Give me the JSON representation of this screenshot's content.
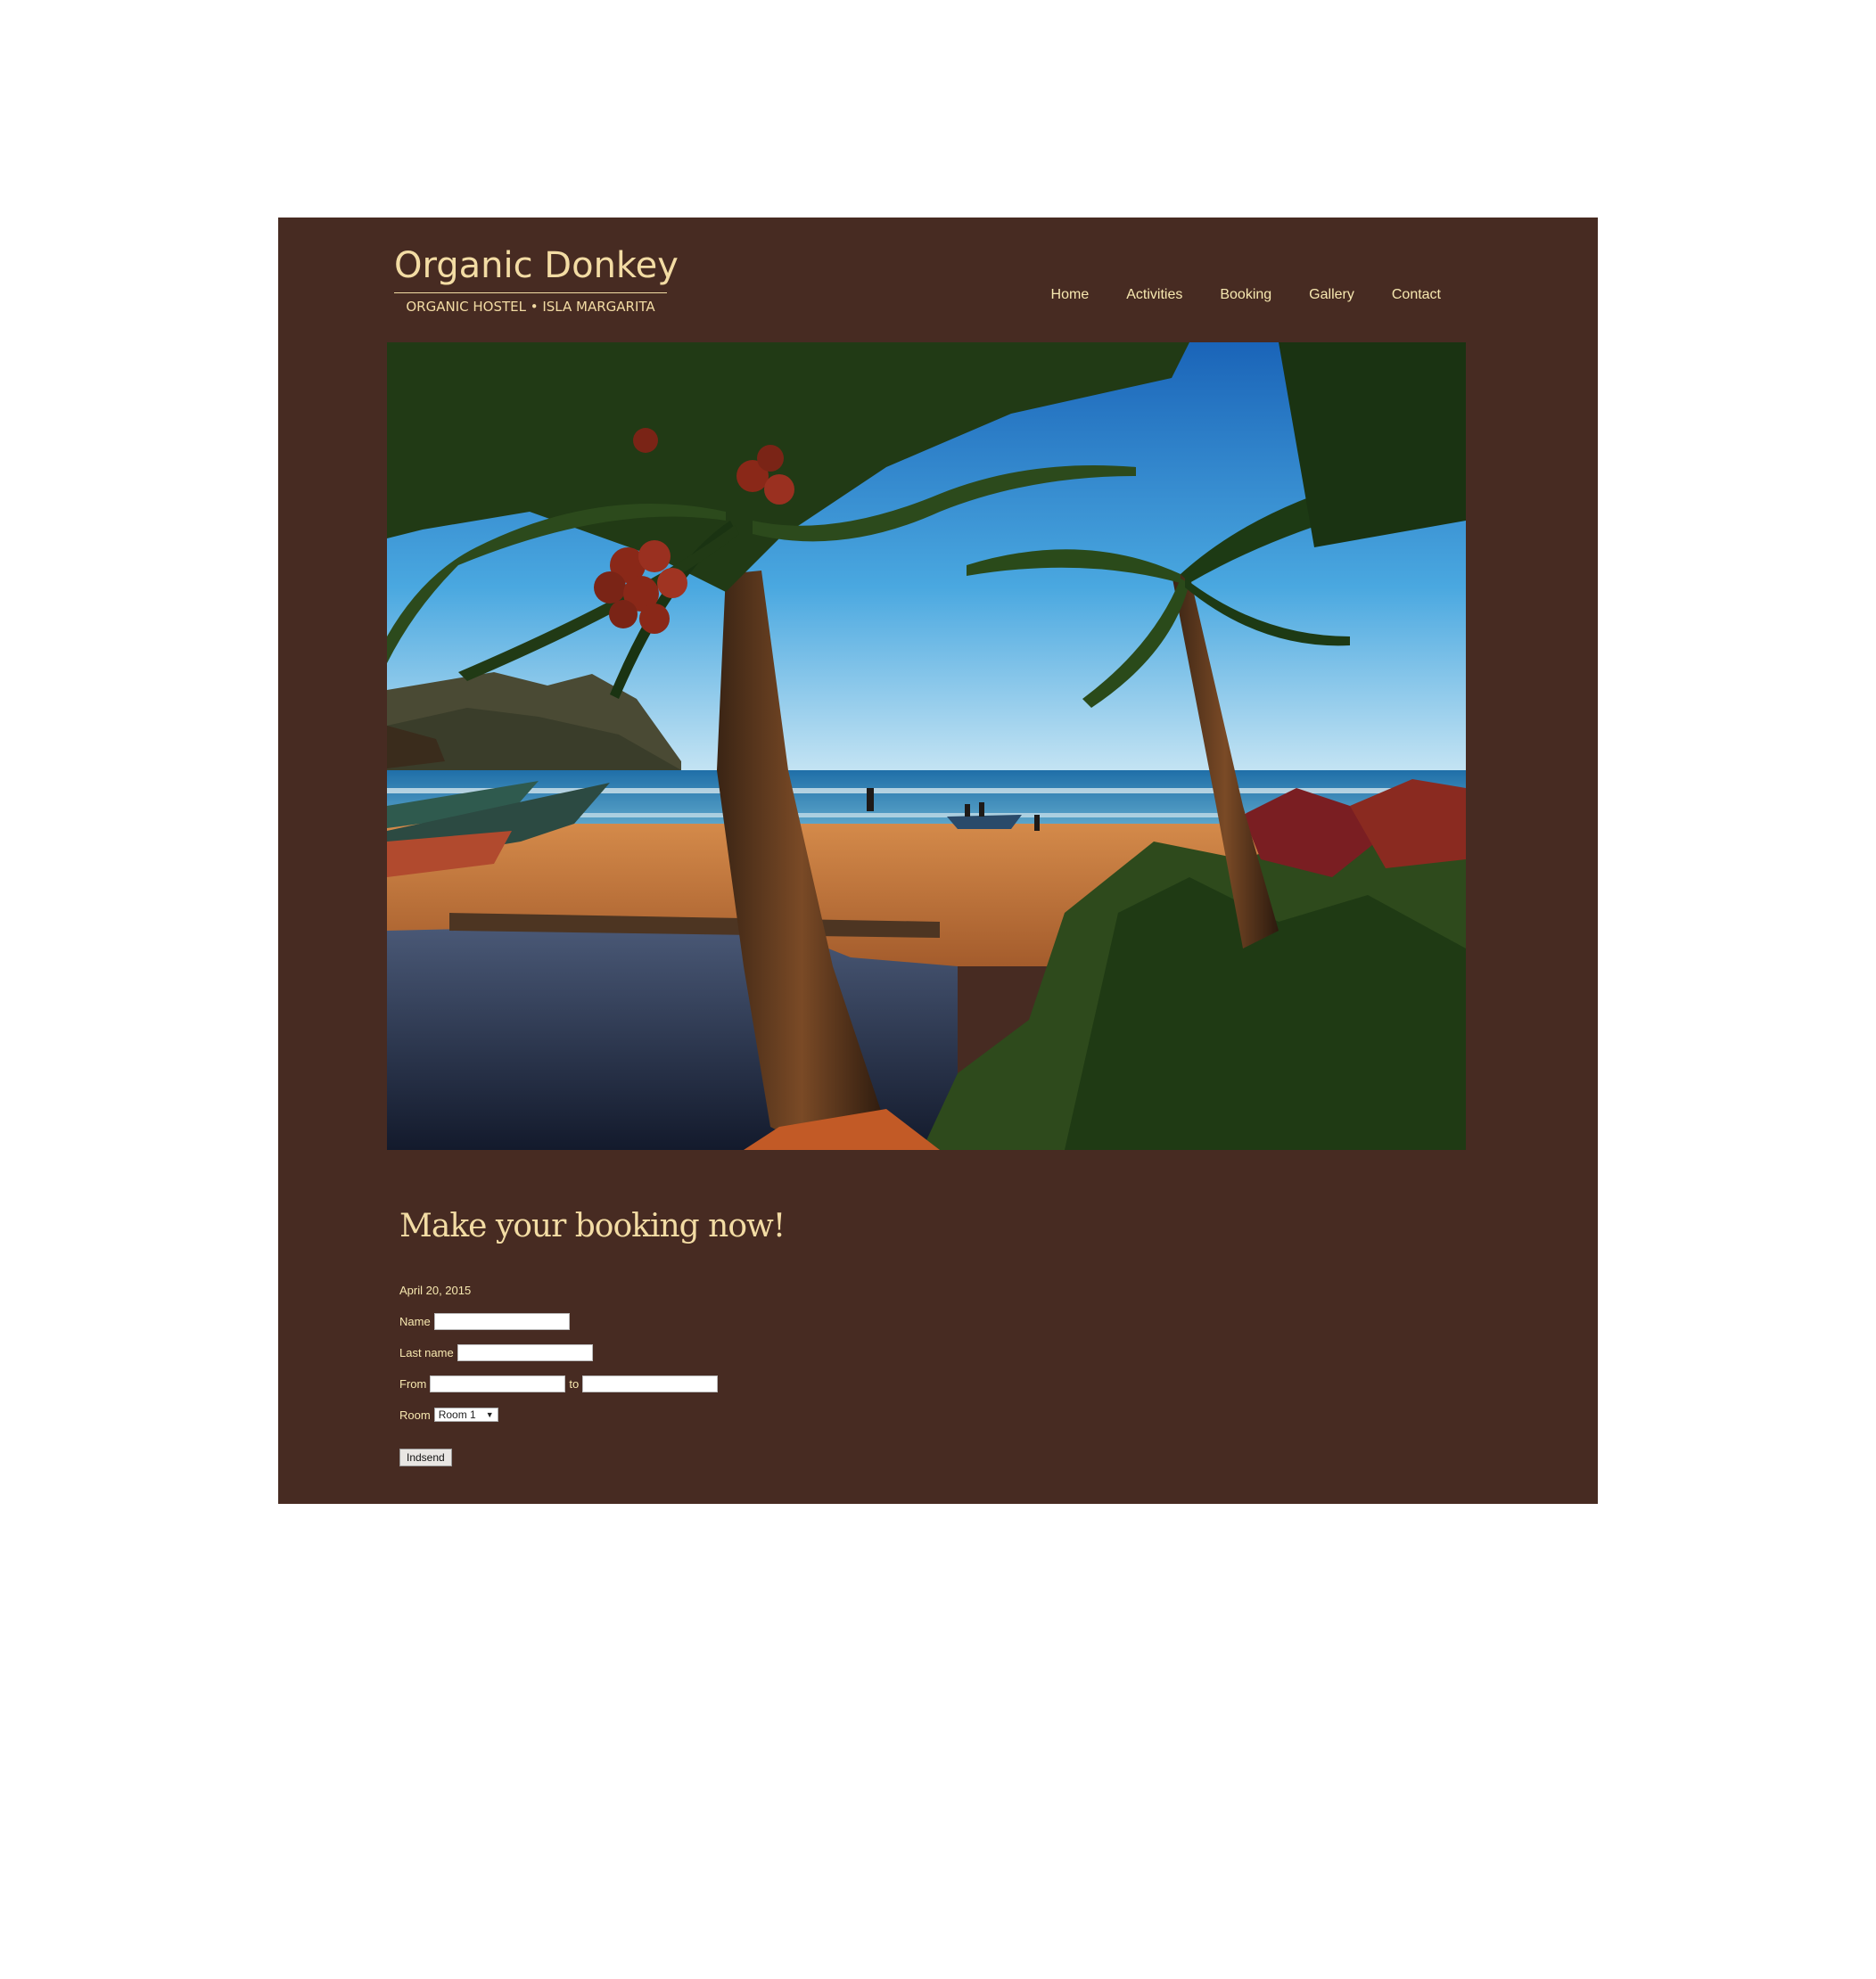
{
  "header": {
    "logo_title": "Organic Donkey",
    "logo_subtitle": "ORGANIC HOSTEL • ISLA MARGARITA"
  },
  "nav": {
    "items": [
      "Home",
      "Activities",
      "Booking",
      "Gallery",
      "Contact"
    ]
  },
  "hero": {
    "image": "beach-palm-trees-photo"
  },
  "booking": {
    "heading": "Make your booking now!",
    "date": "April 20, 2015",
    "name_label": "Name",
    "name_value": "",
    "lastname_label": "Last name",
    "lastname_value": "",
    "from_label": "From",
    "from_value": "",
    "to_label": "to",
    "to_value": "",
    "room_label": "Room",
    "room_selected": "Room 1",
    "submit_label": "Indsend"
  },
  "colors": {
    "background": "#472b22",
    "accent_text": "#f3dca4",
    "page": "#ffffff"
  }
}
